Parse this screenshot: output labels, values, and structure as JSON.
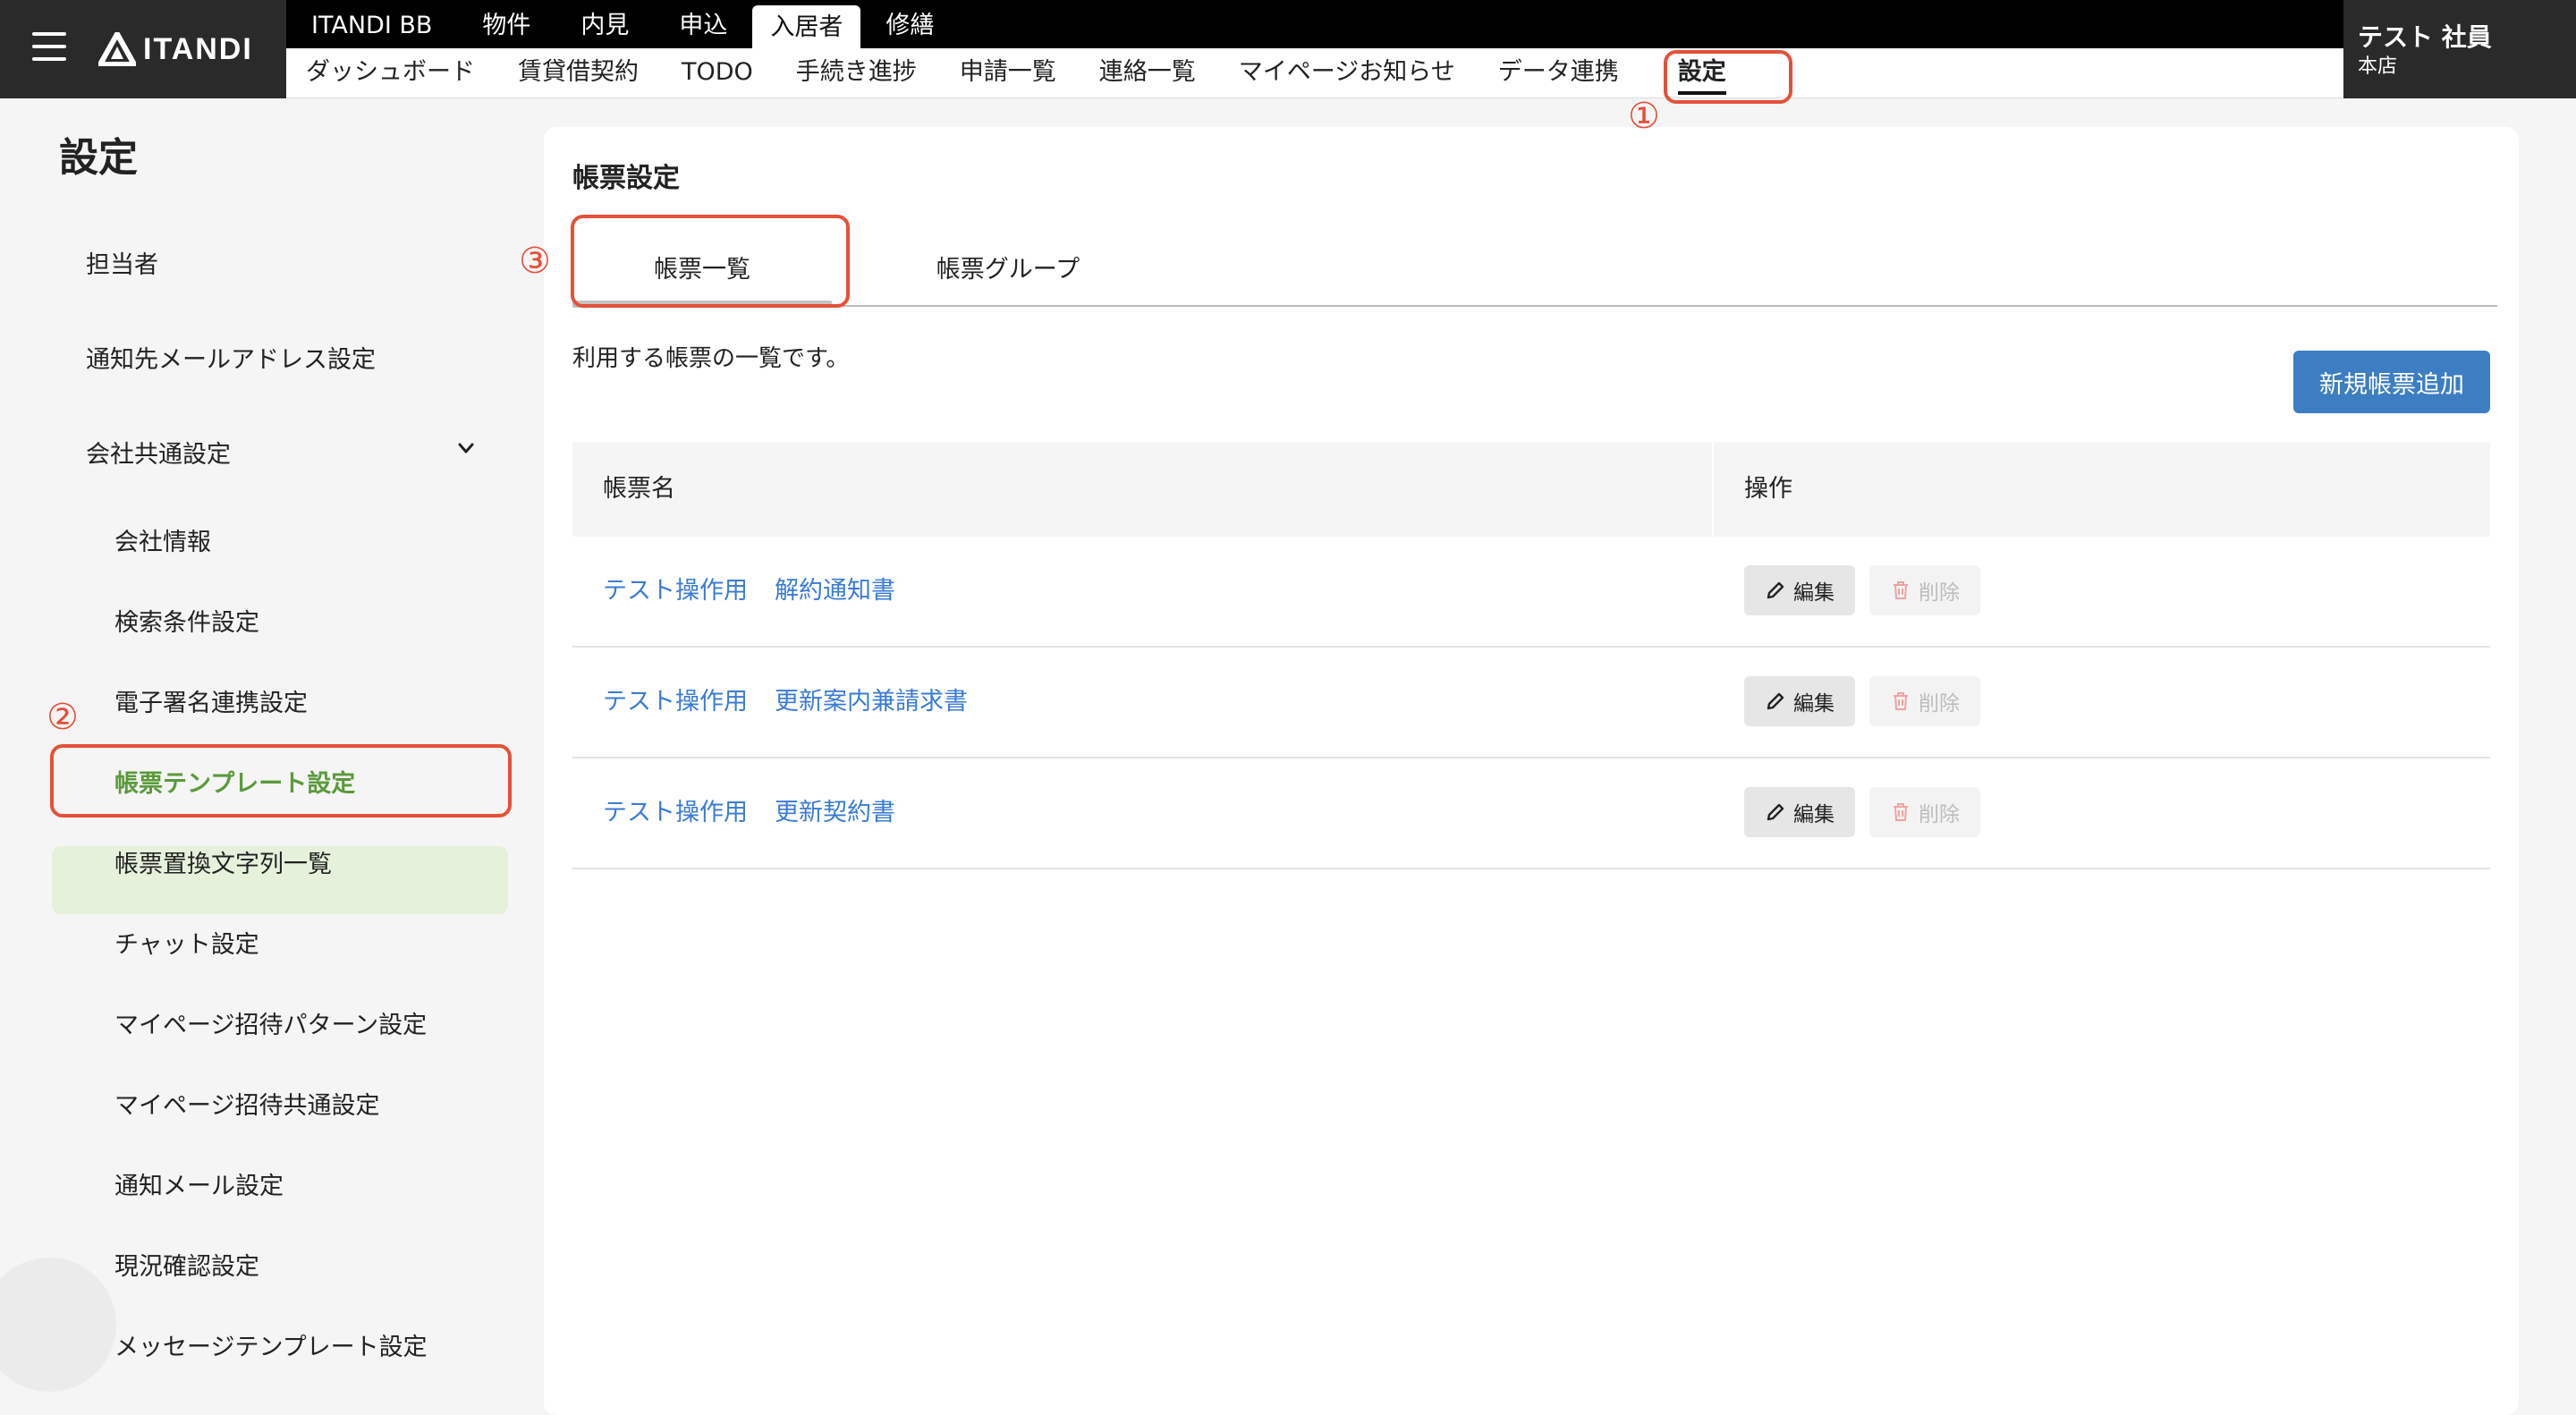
{
  "header": {
    "logo_text": "ITANDI",
    "modules": [
      "ITANDI BB",
      "物件",
      "内見",
      "申込",
      "入居者",
      "修繕"
    ],
    "active_module": "入居者",
    "subnav": [
      "ダッシュボード",
      "賃貸借契約",
      "TODO",
      "手続き進捗",
      "申請一覧",
      "連絡一覧",
      "マイページお知らせ",
      "データ連携",
      "設定"
    ],
    "active_subnav": "設定",
    "user_name": "テスト 社員",
    "user_store": "本店"
  },
  "annotations": {
    "one": "①",
    "two": "②",
    "three": "③"
  },
  "sidebar": {
    "title": "設定",
    "items": [
      "担当者",
      "通知先メールアドレス設定",
      "会社共通設定"
    ],
    "subitems": [
      "会社情報",
      "検索条件設定",
      "電子署名連携設定",
      "帳票テンプレート設定",
      "帳票置換文字列一覧",
      "チャット設定",
      "マイページ招待パターン設定",
      "マイページ招待共通設定",
      "通知メール設定",
      "現況確認設定",
      "メッセージテンプレート設定"
    ],
    "active_subitem": "帳票テンプレート設定"
  },
  "main": {
    "title": "帳票設定",
    "tabs": [
      "帳票一覧",
      "帳票グループ"
    ],
    "description": "利用する帳票の一覧です。",
    "add_button": "新規帳票追加",
    "table": {
      "headers": [
        "帳票名",
        "操作"
      ],
      "rows": [
        {
          "prefix": "テスト操作用",
          "name": "解約通知書"
        },
        {
          "prefix": "テスト操作用",
          "name": "更新案内兼請求書"
        },
        {
          "prefix": "テスト操作用",
          "name": "更新契約書"
        }
      ],
      "edit_label": "編集",
      "delete_label": "削除"
    }
  },
  "colors": {
    "accent": "#3d7ec2",
    "link": "#3a7bd5",
    "annotation": "#e55039",
    "active_green": "#5a9a3a"
  }
}
